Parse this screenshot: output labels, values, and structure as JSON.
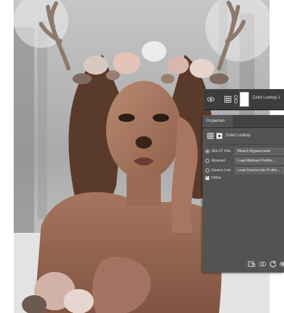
{
  "layer": {
    "name": "Color Lookup 1",
    "icons": [
      "eye-icon",
      "grid-icon",
      "chain-icon",
      "mask-thumbnail"
    ]
  },
  "properties": {
    "tab_label": "Properties",
    "title": "Color Lookup",
    "options": [
      {
        "label": "3DLUT File",
        "value": "Bleach Bypass.look",
        "selected": true
      },
      {
        "label": "Abstract",
        "value": "Load Abstract Profile...",
        "selected": false
      },
      {
        "label": "Device Link",
        "value": "Load DeviceLink Profile...",
        "selected": false
      }
    ],
    "dither": {
      "label": "Dither",
      "checked": true
    },
    "footer_icons": [
      "clip-to-layer-icon",
      "view-previous-icon",
      "reset-icon",
      "visibility-icon"
    ]
  },
  "colors": {
    "panel_bg": "#535353",
    "tab_bar": "#424242",
    "text": "#e4e4e4"
  }
}
